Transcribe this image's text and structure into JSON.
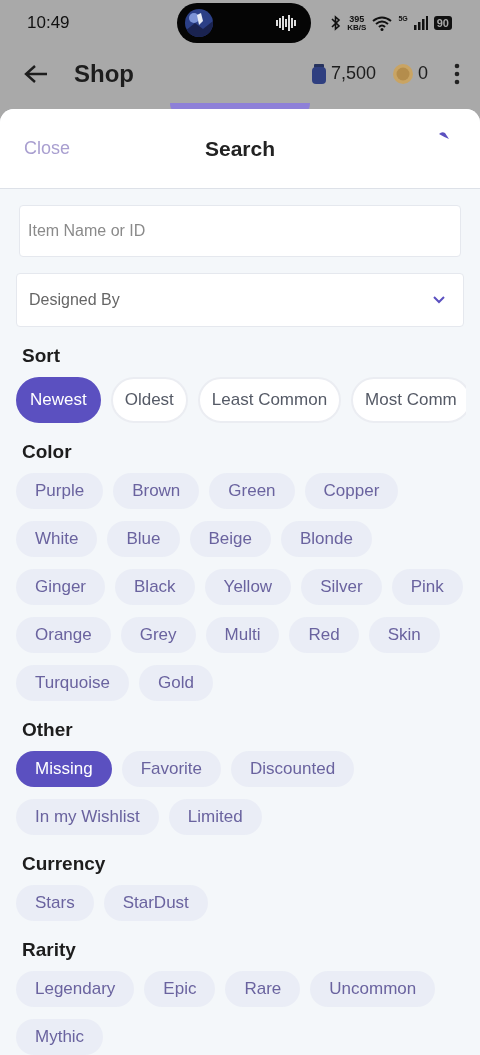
{
  "status_bar": {
    "time": "10:49",
    "speed": "395",
    "speed_unit": "KB/S",
    "network": "5G",
    "battery": "90"
  },
  "app_bar": {
    "title": "Shop",
    "jars": "7,500",
    "coins": "0"
  },
  "sheet": {
    "close": "Close",
    "title": "Search"
  },
  "search": {
    "placeholder": "Item Name or ID"
  },
  "designer_select": {
    "placeholder": "Designed By"
  },
  "sections": [
    {
      "title": "Sort",
      "kind": "sort",
      "chips": [
        {
          "label": "Newest",
          "selected": true
        },
        {
          "label": "Oldest",
          "selected": false
        },
        {
          "label": "Least Common",
          "selected": false
        },
        {
          "label": "Most Comm",
          "selected": false
        }
      ]
    },
    {
      "title": "Color",
      "kind": "filter",
      "chips": [
        {
          "label": "Purple",
          "selected": false
        },
        {
          "label": "Brown",
          "selected": false
        },
        {
          "label": "Green",
          "selected": false
        },
        {
          "label": "Copper",
          "selected": false
        },
        {
          "label": "White",
          "selected": false
        },
        {
          "label": "Blue",
          "selected": false
        },
        {
          "label": "Beige",
          "selected": false
        },
        {
          "label": "Blonde",
          "selected": false
        },
        {
          "label": "Ginger",
          "selected": false
        },
        {
          "label": "Black",
          "selected": false
        },
        {
          "label": "Yellow",
          "selected": false
        },
        {
          "label": "Silver",
          "selected": false
        },
        {
          "label": "Pink",
          "selected": false
        },
        {
          "label": "Orange",
          "selected": false
        },
        {
          "label": "Grey",
          "selected": false
        },
        {
          "label": "Multi",
          "selected": false
        },
        {
          "label": "Red",
          "selected": false
        },
        {
          "label": "Skin",
          "selected": false
        },
        {
          "label": "Turquoise",
          "selected": false
        },
        {
          "label": "Gold",
          "selected": false
        }
      ]
    },
    {
      "title": "Other",
      "kind": "filter",
      "chips": [
        {
          "label": "Missing",
          "selected": true
        },
        {
          "label": "Favorite",
          "selected": false
        },
        {
          "label": "Discounted",
          "selected": false
        },
        {
          "label": "In my Wishlist",
          "selected": false
        },
        {
          "label": "Limited",
          "selected": false
        }
      ]
    },
    {
      "title": "Currency",
      "kind": "filter",
      "chips": [
        {
          "label": "Stars",
          "selected": false
        },
        {
          "label": "StarDust",
          "selected": false
        }
      ]
    },
    {
      "title": "Rarity",
      "kind": "filter",
      "chips": [
        {
          "label": "Legendary",
          "selected": false
        },
        {
          "label": "Epic",
          "selected": false
        },
        {
          "label": "Rare",
          "selected": false
        },
        {
          "label": "Uncommon",
          "selected": false
        },
        {
          "label": "Mythic",
          "selected": false
        }
      ]
    }
  ]
}
